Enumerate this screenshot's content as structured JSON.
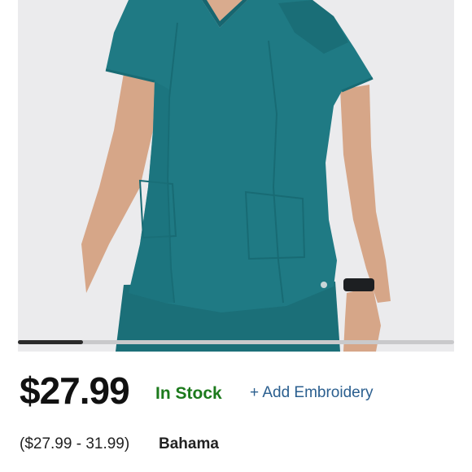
{
  "product": {
    "price": "$27.99",
    "stock_status": "In Stock",
    "embroidery_link": "+ Add Embroidery",
    "price_range": "($27.99 - 31.99)",
    "color_name": "Bahama"
  },
  "gallery": {
    "scroll_position_fraction": 0.15,
    "image_subject": "teal-scrub-top"
  },
  "colors": {
    "scrub_teal": "#1f7a84",
    "in_stock_green": "#1c7a1c",
    "link_blue": "#2b5f8f",
    "image_background": "#ebebed"
  }
}
